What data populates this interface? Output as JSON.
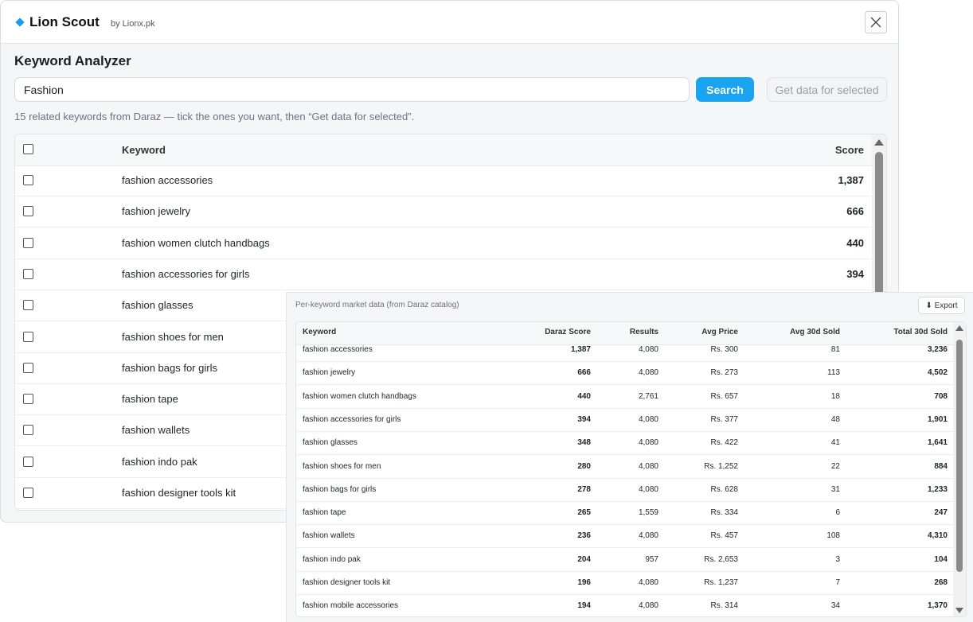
{
  "app": {
    "title": "Lion Scout",
    "byline": "by Lionx.pk",
    "accent": "#1aa3ee"
  },
  "analyzer": {
    "title": "Keyword Analyzer",
    "search_value": "Fashion",
    "search_label": "Search",
    "getdata_label": "Get data for selected",
    "hint": "15 related keywords from Daraz — tick the ones you want, then “Get data for selected”."
  },
  "kw_table": {
    "col_keyword": "Keyword",
    "col_score": "Score",
    "rows": [
      {
        "keyword": "fashion accessories",
        "score": "1,387"
      },
      {
        "keyword": "fashion jewelry",
        "score": "666"
      },
      {
        "keyword": "fashion women clutch handbags",
        "score": "440"
      },
      {
        "keyword": "fashion accessories for girls",
        "score": "394"
      },
      {
        "keyword": "fashion glasses",
        "score": ""
      },
      {
        "keyword": "fashion shoes for men",
        "score": ""
      },
      {
        "keyword": "fashion bags for girls",
        "score": ""
      },
      {
        "keyword": "fashion tape",
        "score": ""
      },
      {
        "keyword": "fashion wallets",
        "score": ""
      },
      {
        "keyword": "fashion indo pak",
        "score": ""
      },
      {
        "keyword": "fashion designer tools kit",
        "score": ""
      }
    ]
  },
  "market": {
    "title": "Per-keyword market data (from Daraz catalog)",
    "export_label": "⬇ Export",
    "headers": [
      "Keyword",
      "Daraz Score",
      "Results",
      "Avg Price",
      "Avg 30d Sold",
      "Total 30d Sold"
    ],
    "rows": [
      [
        "fashion accessories",
        "1,387",
        "4,080",
        "Rs. 300",
        "81",
        "3,236"
      ],
      [
        "fashion jewelry",
        "666",
        "4,080",
        "Rs. 273",
        "113",
        "4,502"
      ],
      [
        "fashion women clutch handbags",
        "440",
        "2,761",
        "Rs. 657",
        "18",
        "708"
      ],
      [
        "fashion accessories for girls",
        "394",
        "4,080",
        "Rs. 377",
        "48",
        "1,901"
      ],
      [
        "fashion glasses",
        "348",
        "4,080",
        "Rs. 422",
        "41",
        "1,641"
      ],
      [
        "fashion shoes for men",
        "280",
        "4,080",
        "Rs. 1,252",
        "22",
        "884"
      ],
      [
        "fashion bags for girls",
        "278",
        "4,080",
        "Rs. 628",
        "31",
        "1,233"
      ],
      [
        "fashion tape",
        "265",
        "1,559",
        "Rs. 334",
        "6",
        "247"
      ],
      [
        "fashion wallets",
        "236",
        "4,080",
        "Rs. 457",
        "108",
        "4,310"
      ],
      [
        "fashion indo pak",
        "204",
        "957",
        "Rs. 2,653",
        "3",
        "104"
      ],
      [
        "fashion designer tools kit",
        "196",
        "4,080",
        "Rs. 1,237",
        "7",
        "268"
      ],
      [
        "fashion mobile accessories",
        "194",
        "4,080",
        "Rs. 314",
        "34",
        "1,370"
      ]
    ]
  }
}
